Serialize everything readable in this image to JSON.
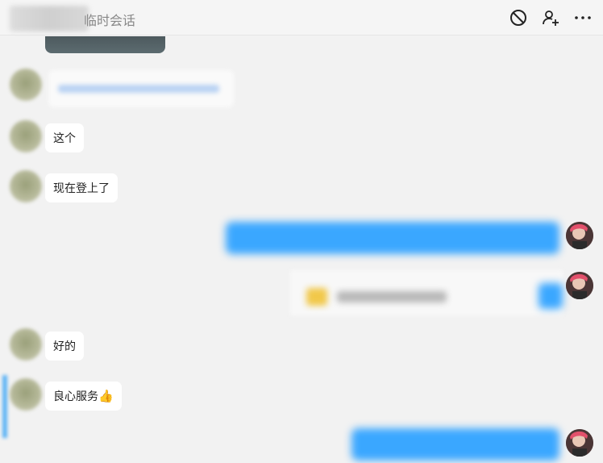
{
  "header": {
    "title_suffix": "临时会话",
    "icons": [
      "block-icon",
      "add-person-icon",
      "more-icon"
    ]
  },
  "messages": [
    {
      "side": "left",
      "type": "image"
    },
    {
      "side": "left",
      "type": "link"
    },
    {
      "side": "left",
      "type": "text",
      "text": "这个"
    },
    {
      "side": "left",
      "type": "text",
      "text": "现在登上了"
    },
    {
      "side": "right",
      "type": "text-blurred"
    },
    {
      "side": "right",
      "type": "card-blurred"
    },
    {
      "side": "left",
      "type": "text",
      "text": "好的"
    },
    {
      "side": "left",
      "type": "text",
      "text": "良心服务",
      "emoji": "👍"
    },
    {
      "side": "right",
      "type": "text-blurred"
    }
  ],
  "colors": {
    "background": "#f2f2f2",
    "bubble_left": "#ffffff",
    "bubble_right": "#3aa7ff"
  }
}
